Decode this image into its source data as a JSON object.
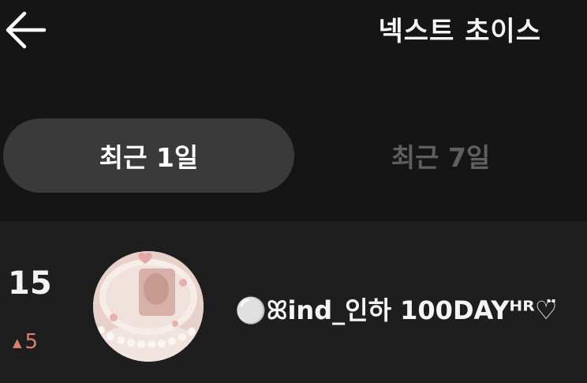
{
  "header": {
    "back_icon": "arrow-left-icon",
    "title": "넥스트 초이스"
  },
  "tabs": [
    {
      "label": "최근 1일",
      "active": true
    },
    {
      "label": "최근 7일",
      "active": false
    }
  ],
  "ranking": [
    {
      "rank": "15",
      "change_icon": "triangle-up-icon",
      "change": "5",
      "name": "⚪️ꕤind_인하 100DAYᴴᴿ♡̈",
      "thumbnail_icon": "cake-thumbnail"
    }
  ],
  "colors": {
    "background": "#151515",
    "list_background": "#1e1e1e",
    "active_tab": "#3a3a3a",
    "inactive_tab_text": "#5f5f5f",
    "rank_up": "#d9826a"
  }
}
